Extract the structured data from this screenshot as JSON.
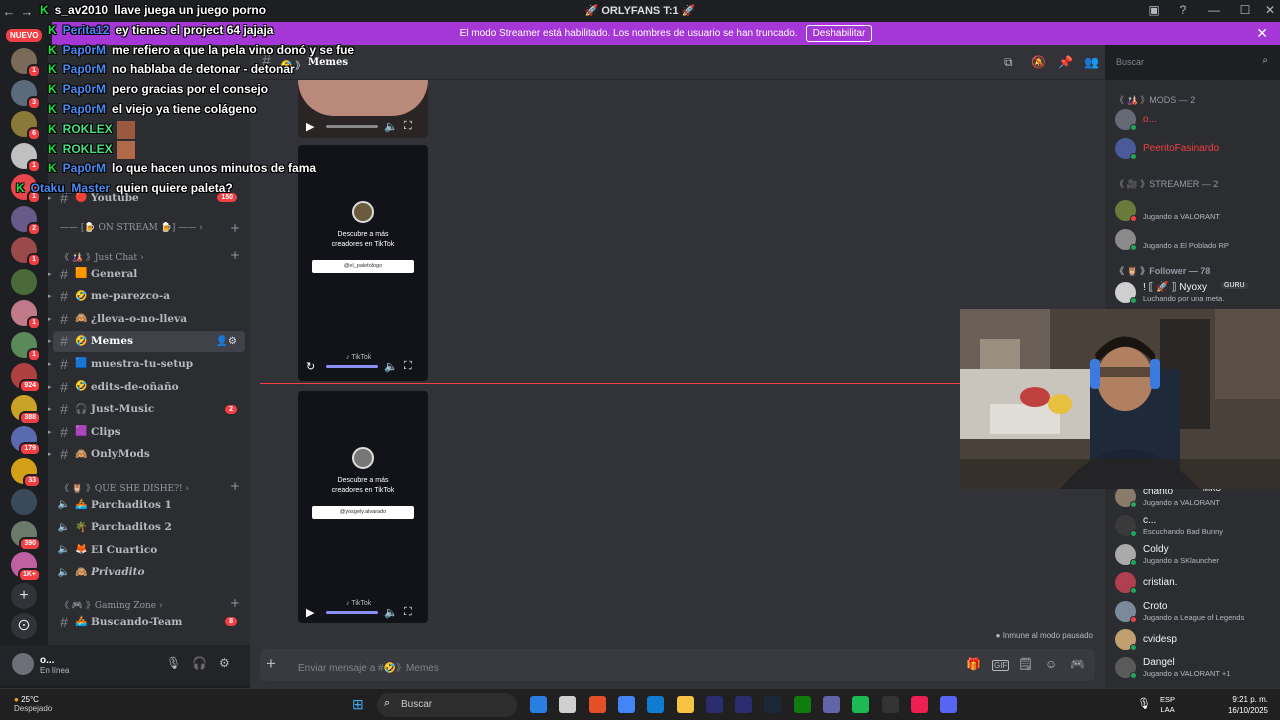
{
  "window": {
    "title": "🚀 ORLYFANS T:1 🚀",
    "nav_back": "←",
    "nav_forward": "→",
    "controls": [
      "▣",
      "?",
      "—",
      "☐",
      "✕"
    ]
  },
  "banner": {
    "text": "El modo Streamer está habilitado. Los nombres de usuario se han truncado.",
    "button": "Deshabilitar",
    "close": "✕"
  },
  "rail": {
    "new_badge": "NUEVO",
    "servers": [
      {
        "color": "#7a6a5a",
        "badge": "1"
      },
      {
        "color": "#5b6b7b",
        "badge": "3"
      },
      {
        "color": "#8a7a3a",
        "badge": "6"
      },
      {
        "color": "#c0c0c0",
        "badge": "1"
      },
      {
        "color": "#e9464b",
        "badge": "1"
      },
      {
        "color": "#6a5a8a",
        "badge": "2"
      },
      {
        "color": "#9a4a4a",
        "badge": "1"
      },
      {
        "color": "#4a6a3a",
        "badge": ""
      },
      {
        "color": "#c07a8a",
        "badge": "1"
      },
      {
        "color": "#5a8a5a",
        "badge": "1"
      },
      {
        "color": "#b04040",
        "badge": "924"
      },
      {
        "color": "#c9a227",
        "badge": "388"
      },
      {
        "color": "#5a6ab0",
        "badge": "179"
      },
      {
        "color": "#d4a017",
        "badge": "33"
      },
      {
        "color": "#3a4a5a",
        "badge": ""
      },
      {
        "color": "#6b7a6a",
        "badge": "390"
      },
      {
        "color": "#c060a0",
        "badge": "1K+"
      }
    ],
    "add": "+",
    "discover": "⊙"
  },
  "sidebar": {
    "channels_top": [
      {
        "emoji": "🔴",
        "label": "Youtube",
        "count": "150"
      }
    ],
    "categories": [
      {
        "label": "—— [🍺 ON STREAM 🍺] —— ›"
      },
      {
        "label": "《 🎎 》Just Chat ›"
      },
      {
        "label": "《 🦉 》QUE SHE DISHE?! ›"
      },
      {
        "label": "《 🎮 》Gaming Zone ›"
      }
    ],
    "channels": [
      {
        "emoji": "🟧",
        "label": "General",
        "count": ""
      },
      {
        "emoji": "🤣",
        "label": "me-parezco-a",
        "count": ""
      },
      {
        "emoji": "🙈",
        "label": "¿lleva-o-no-lleva",
        "count": ""
      },
      {
        "emoji": "🤣",
        "label": "Memes",
        "count": ""
      },
      {
        "emoji": "🟦",
        "label": "muestra-tu-setup",
        "count": ""
      },
      {
        "emoji": "🤣",
        "label": "edits-de-oñaño",
        "count": ""
      },
      {
        "emoji": "🎧",
        "label": "Just-Music",
        "count": "2"
      },
      {
        "emoji": "🟪",
        "label": "Clips",
        "count": ""
      },
      {
        "emoji": "🙈",
        "label": "OnlyMods",
        "count": ""
      }
    ],
    "voice": [
      {
        "emoji": "🚣",
        "label": "Parchaditos 1"
      },
      {
        "emoji": "🌴",
        "label": "Parchaditos 2"
      },
      {
        "emoji": "🦊",
        "label": "El Cuartico"
      },
      {
        "emoji": "🙈",
        "label": "Privadito"
      }
    ],
    "gaming": {
      "emoji": "🚣",
      "label": "Buscando-Team",
      "count": "8"
    }
  },
  "user": {
    "name": "o...",
    "status": "En línea",
    "icons": [
      "🎙",
      "🎧",
      "⚙"
    ]
  },
  "channel": {
    "name": "Memes",
    "header_prefix": "🤣 》",
    "header_icons": [
      "⧉",
      "🔕",
      "📌",
      "👥"
    ]
  },
  "search": {
    "placeholder": "Buscar",
    "icon": "⌕"
  },
  "tiktok": [
    {
      "text1": "Descubre a más",
      "text2": "creadores en TikTok",
      "handle": "@el_paletologo",
      "logo": "♪ TikTok"
    },
    {
      "text1": "Descubre a más",
      "text2": "creadores en TikTok",
      "handle": "@yosgely.alvarado",
      "logo": "♪ TikTok"
    }
  ],
  "paused_text": "Inmune al modo pausado",
  "composer": {
    "placeholder": "Enviar mensaje a #🤣》Memes",
    "icons": [
      "🎁",
      "GIF",
      "🗒",
      "☺",
      "🎮"
    ]
  },
  "members": {
    "groups": [
      {
        "label": "《 🎎 》MODS — 2"
      },
      {
        "label": "《 🎥 》STREAMER — 2"
      },
      {
        "label": "《 🦉 》Follower — 78"
      }
    ],
    "list": [
      {
        "name": "o...",
        "status": "",
        "color": "#f23f43",
        "avatar": "#666a74",
        "dot": "#23a55a"
      },
      {
        "name": "PeeritoFasinardo",
        "status": "",
        "color": "#f23f43",
        "avatar": "#4a5a9a",
        "dot": "#23a55a"
      },
      {
        "name": "",
        "status": "Jugando a VALORANT",
        "color": "#a437d6",
        "avatar": "#6a7a3a",
        "dot": "#f23f43"
      },
      {
        "name": "",
        "status": "Jugando a El Poblado RP",
        "color": "#a437d6",
        "avatar": "#8a8a8a",
        "dot": "#23a55a"
      },
      {
        "name": "! ⟦ 🚀 ⟧ Nyoxy",
        "status": "Luchando por una meta.",
        "color": "#f2f3f5",
        "avatar": "#cfcfcf",
        "dot": "#23a55a"
      },
      {
        "name": "charito",
        "status": "Jugando a VALORANT",
        "color": "#f2f3f5",
        "avatar": "#8a7a6a",
        "dot": "#23a55a"
      },
      {
        "name": "c...",
        "status": "Escuchando Bad Bunny",
        "color": "#f2f3f5",
        "avatar": "#3a3a3a",
        "dot": "#23a55a"
      },
      {
        "name": "Coldy",
        "status": "Jugando a SKlauncher",
        "color": "#f2f3f5",
        "avatar": "#aaa",
        "dot": "#23a55a"
      },
      {
        "name": "cristian.",
        "status": "",
        "color": "#f2f3f5",
        "avatar": "#b04050",
        "dot": "#23a55a"
      },
      {
        "name": "Croto",
        "status": "Jugando a League of Legends",
        "color": "#f2f3f5",
        "avatar": "#7a8a9a",
        "dot": "#f23f43"
      },
      {
        "name": "cvidesp",
        "status": "",
        "color": "#f2f3f5",
        "avatar": "#c0a070",
        "dot": "#23a55a"
      },
      {
        "name": "Dangel",
        "status": "Jugando a VALORANT +1",
        "color": "#f2f3f5",
        "avatar": "#5a5a5a",
        "dot": "#23a55a"
      }
    ],
    "guru_tag": "GURU",
    "miko_tag": "MIKO"
  },
  "overlay_chat": [
    {
      "user": "s_av2010",
      "text": "llave juega un juego porno",
      "ucolor": "white"
    },
    {
      "user": "Perita12",
      "text": "ey tienes el project 64 jajaja",
      "ucolor": "blue"
    },
    {
      "user": "Pap0rM",
      "text": "me refiero a que la pela vino donó y se fue",
      "ucolor": "blue"
    },
    {
      "user": "Pap0rM",
      "text": "no hablaba de detonar - detonar",
      "ucolor": "blue"
    },
    {
      "user": "Pap0rM",
      "text": "pero gracias por el consejo",
      "ucolor": "blue"
    },
    {
      "user": "Pap0rM",
      "text": "el viejo ya tiene colágeno",
      "ucolor": "blue"
    },
    {
      "user": "ROKLEX",
      "text": "",
      "ucolor": "green"
    },
    {
      "user": "ROKLEX",
      "text": "",
      "ucolor": "green"
    },
    {
      "user": "Pap0rM",
      "text": "lo que hacen unos minutos de fama",
      "ucolor": "blue"
    },
    {
      "user": "Otaku_Master",
      "text": "quien quiere paleta?",
      "ucolor": "blue"
    }
  ],
  "taskbar": {
    "temp": "25°C",
    "weather": "Despejado",
    "search": "Buscar",
    "lang1": "ESP",
    "lang2": "LAA",
    "time": "9:21 p. m.",
    "date": "16/10/2025",
    "apps": [
      "#2a7de1",
      "#cfcfcf",
      "#e34f26",
      "#4285f4",
      "#0f7bd1",
      "#f6c343",
      "#2b2b6f",
      "#2b2b6f",
      "#1b2838",
      "#107c10",
      "#6264a7",
      "#1db954",
      "#333",
      "#ee1d52",
      "#5865f2"
    ]
  }
}
